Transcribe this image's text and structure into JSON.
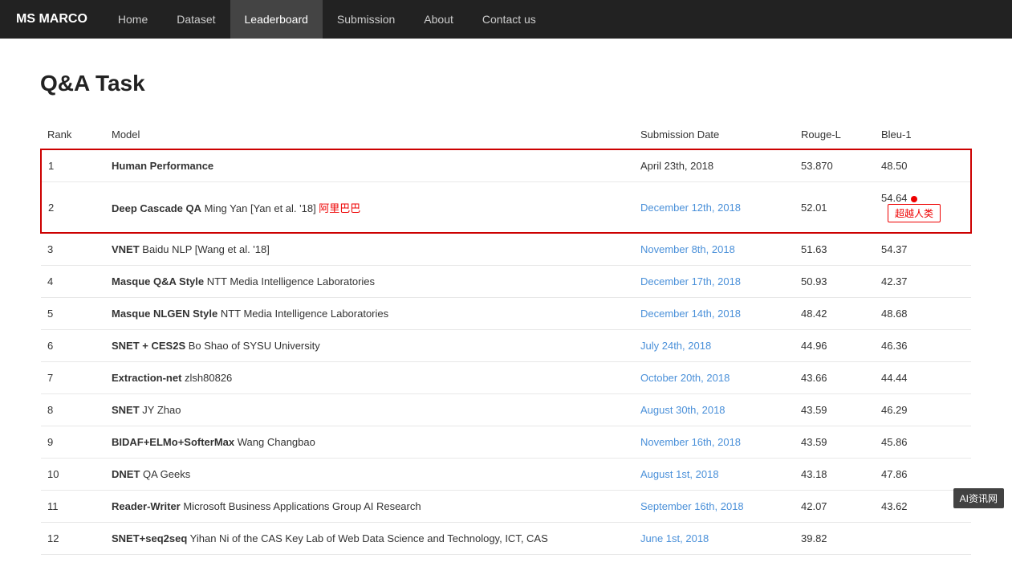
{
  "brand": "MS MARCO",
  "nav": {
    "items": [
      {
        "label": "Home",
        "active": false
      },
      {
        "label": "Dataset",
        "active": false
      },
      {
        "label": "Leaderboard",
        "active": true
      },
      {
        "label": "Submission",
        "active": false
      },
      {
        "label": "About",
        "active": false
      },
      {
        "label": "Contact us",
        "active": false
      }
    ]
  },
  "page": {
    "title": "Q&A Task"
  },
  "table": {
    "columns": [
      "Rank",
      "Model",
      "Submission Date",
      "Rouge-L",
      "Bleu-1"
    ],
    "rows": [
      {
        "rank": "1",
        "model_bold": "Human Performance",
        "model_rest": "",
        "date": "April 23th, 2018",
        "date_link": false,
        "rouge": "53.870",
        "bleu": "48.50",
        "highlight": true,
        "exceed": false,
        "red_dot": false
      },
      {
        "rank": "2",
        "model_bold": "Deep Cascade QA",
        "model_rest": "Ming Yan [Yan et al. '18]",
        "model_cn": "阿里巴巴",
        "date": "December 12th, 2018",
        "date_link": true,
        "rouge": "52.01",
        "bleu": "54.64",
        "highlight": true,
        "exceed": true,
        "exceed_label": "超越人类",
        "red_dot": true
      },
      {
        "rank": "3",
        "model_bold": "VNET",
        "model_rest": "Baidu NLP [Wang et al. '18]",
        "date": "November 8th, 2018",
        "date_link": true,
        "rouge": "51.63",
        "bleu": "54.37",
        "highlight": false
      },
      {
        "rank": "4",
        "model_bold": "Masque Q&A Style",
        "model_rest": "NTT Media Intelligence Laboratories",
        "date": "December 17th, 2018",
        "date_link": true,
        "rouge": "50.93",
        "bleu": "42.37",
        "highlight": false
      },
      {
        "rank": "5",
        "model_bold": "Masque NLGEN Style",
        "model_rest": "NTT Media Intelligence Laboratories",
        "date": "December 14th, 2018",
        "date_link": true,
        "rouge": "48.42",
        "bleu": "48.68",
        "highlight": false
      },
      {
        "rank": "6",
        "model_bold": "SNET + CES2S",
        "model_rest": "Bo Shao of SYSU University",
        "date": "July 24th, 2018",
        "date_link": true,
        "rouge": "44.96",
        "bleu": "46.36",
        "highlight": false
      },
      {
        "rank": "7",
        "model_bold": "Extraction-net",
        "model_rest": "zlsh80826",
        "date": "October 20th, 2018",
        "date_link": true,
        "rouge": "43.66",
        "bleu": "44.44",
        "highlight": false
      },
      {
        "rank": "8",
        "model_bold": "SNET",
        "model_rest": "JY Zhao",
        "date": "August 30th, 2018",
        "date_link": true,
        "rouge": "43.59",
        "bleu": "46.29",
        "highlight": false
      },
      {
        "rank": "9",
        "model_bold": "BIDAF+ELMo+SofterMax",
        "model_rest": "Wang Changbao",
        "date": "November 16th, 2018",
        "date_link": true,
        "rouge": "43.59",
        "bleu": "45.86",
        "highlight": false
      },
      {
        "rank": "10",
        "model_bold": "DNET",
        "model_rest": "QA Geeks",
        "date": "August 1st, 2018",
        "date_link": true,
        "rouge": "43.18",
        "bleu": "47.86",
        "highlight": false
      },
      {
        "rank": "11",
        "model_bold": "Reader-Writer",
        "model_rest": "Microsoft Business Applications Group AI Research",
        "date": "September 16th, 2018",
        "date_link": true,
        "rouge": "42.07",
        "bleu": "43.62",
        "highlight": false
      },
      {
        "rank": "12",
        "model_bold": "SNET+seq2seq",
        "model_rest": "Yihan Ni of the CAS Key Lab of Web Data Science and Technology, ICT, CAS",
        "date": "June 1st, 2018",
        "date_link": true,
        "rouge": "39.82",
        "bleu": "",
        "highlight": false
      }
    ]
  }
}
